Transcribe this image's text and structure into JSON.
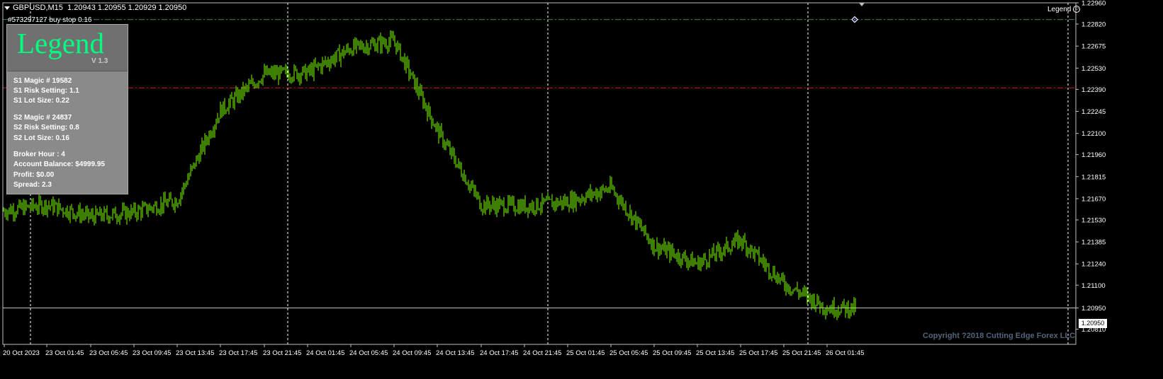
{
  "header": {
    "symbol": "GBPUSD,M15",
    "ohlc": "1.20943 1.20955 1.20929 1.20950"
  },
  "order_label": "#573297127 buy stop 0.16",
  "legend_tag": "Legend",
  "panel": {
    "title": "Legend",
    "version": "V 1.3",
    "lines": [
      "S1 Magic # 19582",
      "S1 Risk Setting: 1.1",
      "S1 Lot Size: 0.22",
      "S2 Magic # 24837",
      "S2 Risk Setting: 0.8",
      "S2 Lot Size: 0.16",
      "Broker Hour : 4",
      "Account Balance: $4999.95",
      "Profit: $0.00",
      "Spread:  2.3"
    ]
  },
  "copyright": "Copyright ?2018 Cutting Edge Forex LLC",
  "current_price": "1.20950",
  "colors": {
    "background": "#000000",
    "candles": "#7cfc00",
    "buy_stop_line": "#2e8b57",
    "red_level": "#c81e1e",
    "grid": "#ffffff"
  },
  "chart_data": {
    "type": "candlestick",
    "title": "GBPUSD,M15",
    "ylim": [
      1.2071,
      1.2296
    ],
    "y_ticks": [
      "1.22960",
      "1.22820",
      "1.22675",
      "1.22530",
      "1.22390",
      "1.22245",
      "1.22100",
      "1.21960",
      "1.21815",
      "1.21670",
      "1.21530",
      "1.21385",
      "1.21240",
      "1.21100",
      "1.20950",
      "1.20810"
    ],
    "x_ticks": [
      "20 Oct 2023",
      "23 Oct 01:45",
      "23 Oct 05:45",
      "23 Oct 09:45",
      "23 Oct 13:45",
      "23 Oct 17:45",
      "23 Oct 21:45",
      "24 Oct 01:45",
      "24 Oct 05:45",
      "24 Oct 09:45",
      "24 Oct 13:45",
      "24 Oct 17:45",
      "24 Oct 21:45",
      "25 Oct 01:45",
      "25 Oct 05:45",
      "25 Oct 09:45",
      "25 Oct 13:45",
      "25 Oct 17:45",
      "25 Oct 21:45",
      "26 Oct 01:45"
    ],
    "levels": [
      {
        "price": 1.2285,
        "style": "dash-dot",
        "color": "#2e8b57",
        "label": "buy stop"
      },
      {
        "price": 1.224,
        "style": "dash-dot",
        "color": "#c81e1e"
      },
      {
        "price": 1.2095,
        "style": "solid",
        "color": "#c0c0c0"
      }
    ],
    "close_path": [
      {
        "time": "20 Oct 2023",
        "price": 1.2159
      },
      {
        "time": "23 Oct 01:45",
        "price": 1.2163
      },
      {
        "time": "23 Oct 05:45",
        "price": 1.2155
      },
      {
        "time": "23 Oct 09:45",
        "price": 1.2158
      },
      {
        "time": "23 Oct 13:45",
        "price": 1.2166
      },
      {
        "time": "23 Oct 17:45",
        "price": 1.2225
      },
      {
        "time": "23 Oct 21:45",
        "price": 1.2249
      },
      {
        "time": "24 Oct 01:45",
        "price": 1.225
      },
      {
        "time": "24 Oct 05:45",
        "price": 1.2266
      },
      {
        "time": "24 Oct 09:45",
        "price": 1.2271
      },
      {
        "time": "24 Oct 13:45",
        "price": 1.2212
      },
      {
        "time": "24 Oct 17:45",
        "price": 1.2163
      },
      {
        "time": "24 Oct 21:45",
        "price": 1.2162
      },
      {
        "time": "25 Oct 01:45",
        "price": 1.2165
      },
      {
        "time": "25 Oct 05:45",
        "price": 1.2174
      },
      {
        "time": "25 Oct 09:45",
        "price": 1.2136
      },
      {
        "time": "25 Oct 13:45",
        "price": 1.2124
      },
      {
        "time": "25 Oct 17:45",
        "price": 1.214
      },
      {
        "time": "25 Oct 21:45",
        "price": 1.2111
      },
      {
        "time": "26 Oct 01:45",
        "price": 1.2095
      }
    ]
  }
}
